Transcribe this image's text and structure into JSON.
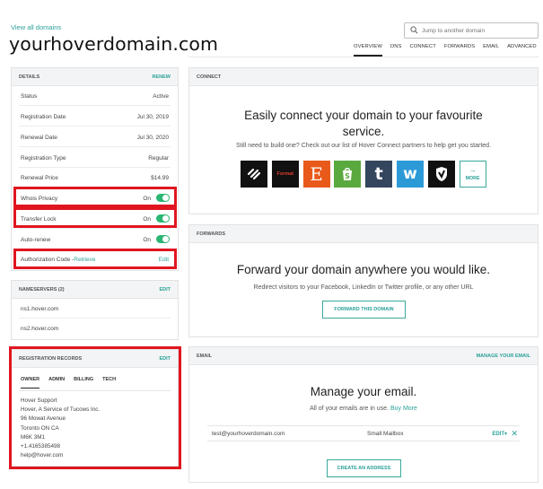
{
  "header": {
    "view_all": "View all domains",
    "domain": "yourhoverdomain.com",
    "search_placeholder": "Jump to another domain",
    "tabs": [
      "OVERVIEW",
      "DNS",
      "CONNECT",
      "FORWARDS",
      "EMAIL",
      "ADVANCED"
    ],
    "active_tab": "OVERVIEW"
  },
  "details": {
    "title": "DETAILS",
    "action": "RENEW",
    "rows": [
      {
        "label": "Status",
        "value": "Active"
      },
      {
        "label": "Registration Date",
        "value": "Jul 30, 2019"
      },
      {
        "label": "Renewal Date",
        "value": "Jul 30, 2020"
      },
      {
        "label": "Registration Type",
        "value": "Regular"
      },
      {
        "label": "Renewal Price",
        "value": "$14.99"
      },
      {
        "label": "Whois Privacy",
        "value": "On",
        "toggle": true
      },
      {
        "label": "Transfer Lock",
        "value": "On",
        "toggle": true
      },
      {
        "label": "Auto-renew",
        "value": "On",
        "toggle": true
      }
    ],
    "auth_label": "Authorization Code -",
    "auth_retrieve": "Retrieve",
    "auth_edit": "Edit"
  },
  "nameservers": {
    "title": "NAMESERVERS (2)",
    "action": "EDIT",
    "items": [
      "ns1.hover.com",
      "ns2.hover.com"
    ]
  },
  "registration_records": {
    "title": "REGISTRATION RECORDS",
    "action": "EDIT",
    "tabs": [
      "OWNER",
      "ADMIN",
      "BILLING",
      "TECH"
    ],
    "lines": [
      "Hover Support",
      "Hover, A Service of Tucows Inc.",
      "96 Mowat Avenue",
      "Toronto ON CA",
      "M6K 3M1",
      "+1.4165385498",
      "help@hover.com"
    ]
  },
  "connect": {
    "title": "CONNECT",
    "headline": "Easily connect your domain to your favourite service.",
    "subtext": "Still need to build one? Check out our list of Hover Connect partners to help get you started.",
    "partners": [
      {
        "name": "squarespace-icon",
        "color": "#111111",
        "glyph": "≋"
      },
      {
        "name": "format-icon",
        "color": "#111111",
        "glyph": "Format"
      },
      {
        "name": "etsy-icon",
        "color": "#e8591a",
        "glyph": "E"
      },
      {
        "name": "shopify-icon",
        "color": "#5aa93f",
        "glyph": "S"
      },
      {
        "name": "tumblr-icon",
        "color": "#34465d",
        "glyph": "t"
      },
      {
        "name": "weebly-icon",
        "color": "#2d9ad8",
        "glyph": "w"
      },
      {
        "name": "shield-icon",
        "color": "#111111",
        "glyph": "◣"
      }
    ],
    "more": "MORE"
  },
  "forwards": {
    "title": "FORWARDS",
    "headline": "Forward your domain anywhere you would like.",
    "subtext": "Redirect visitors to your Facebook, LinkedIn or Twitter profile, or any other URL",
    "button": "FORWARD THIS DOMAIN"
  },
  "email": {
    "title": "EMAIL",
    "action": "MANAGE YOUR EMAIL",
    "headline": "Manage your email.",
    "subtext": "All of your emails are in use.",
    "buy_more": "Buy More",
    "row": {
      "address": "test@yourhoverdomain.com",
      "plan": "Small Mailbox",
      "edit": "EDIT▾",
      "remove": "✕"
    },
    "button": "CREATE AN ADDRESS"
  }
}
